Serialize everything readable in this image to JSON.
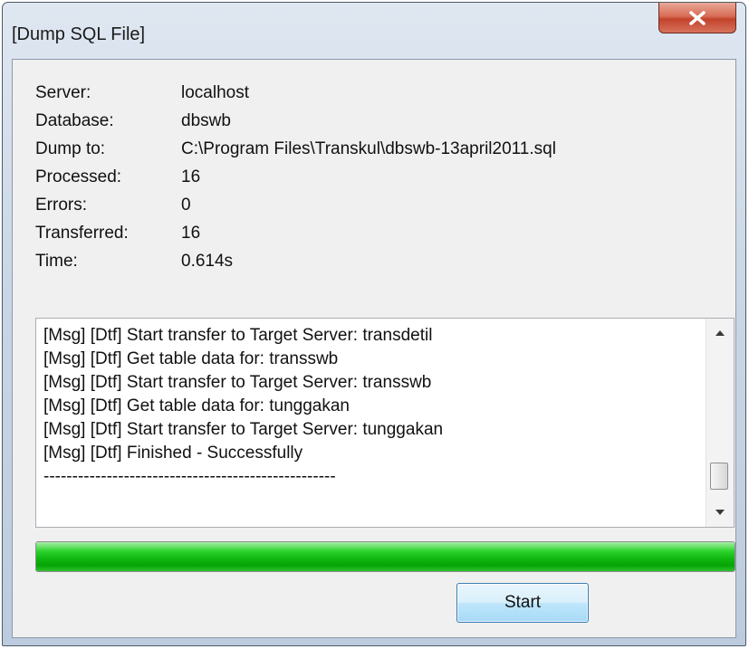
{
  "window": {
    "title": "[Dump SQL File]"
  },
  "info": {
    "server": {
      "label": "Server:",
      "value": "localhost"
    },
    "database": {
      "label": "Database:",
      "value": "dbswb"
    },
    "dump_to": {
      "label": "Dump to:",
      "value": "C:\\Program Files\\Transkul\\dbswb-13april2011.sql"
    },
    "processed": {
      "label": "Processed:",
      "value": "16"
    },
    "errors": {
      "label": "Errors:",
      "value": "0"
    },
    "transferred": {
      "label": "Transferred:",
      "value": "16"
    },
    "time": {
      "label": "Time:",
      "value": "0.614s"
    }
  },
  "log": {
    "lines": [
      "[Msg] [Dtf] Start transfer to Target Server: transdetil",
      "[Msg] [Dtf] Get table data for: transswb",
      "[Msg] [Dtf] Start transfer to Target Server: transswb",
      "[Msg] [Dtf] Get table data for: tunggakan",
      "[Msg] [Dtf] Start transfer to Target Server: tunggakan",
      "[Msg] [Dtf] Finished - Successfully",
      "---------------------------------------------------"
    ]
  },
  "progress": {
    "percent": 100,
    "color": "#12b812"
  },
  "buttons": {
    "start_label": "Start"
  },
  "icons": {
    "close": "close-icon",
    "scroll_up": "arrow-up-icon",
    "scroll_down": "arrow-down-icon"
  }
}
